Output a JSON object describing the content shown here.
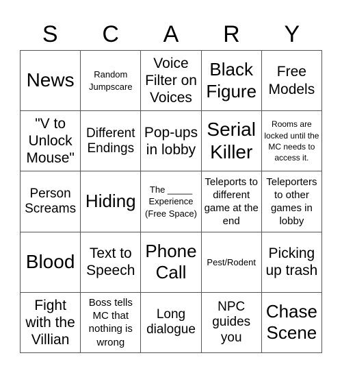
{
  "card": {
    "header": [
      "S",
      "C",
      "A",
      "R",
      "Y"
    ],
    "cells": [
      [
        "News",
        "Random Jumpscare",
        "Voice Filter on Voices",
        "Black Figure",
        "Free Models"
      ],
      [
        "\"V to Unlock Mouse\"",
        "Different Endings",
        "Pop-ups in lobby",
        "Serial Killer",
        "Rooms are locked until the MC needs to access it."
      ],
      [
        "Person Screams",
        "Hiding",
        "The _____ Experience (Free Space)",
        "Teleports to different game at the end",
        "Teleporters to other games in lobby"
      ],
      [
        "Blood",
        "Text to Speech",
        "Phone Call",
        "Pest/Rodent",
        "Picking up trash"
      ],
      [
        "Fight with the Villian",
        "Boss tells MC that nothing is wrong",
        "Long dialogue",
        "NPC guides you",
        "Chase Scene"
      ]
    ],
    "free_space": {
      "row": 2,
      "col": 2
    }
  }
}
